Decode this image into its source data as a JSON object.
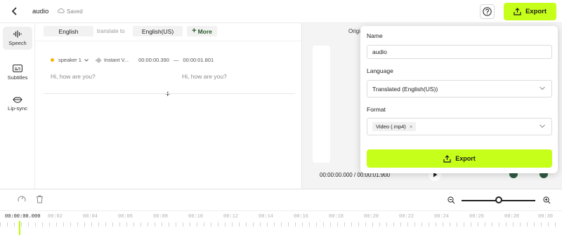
{
  "header": {
    "title": "audio",
    "saved": "Saved",
    "export_label": "Export"
  },
  "rail": {
    "items": [
      {
        "label": "Speech",
        "icon": "waveform-icon"
      },
      {
        "label": "Subtitles",
        "icon": "subtitles-icon"
      },
      {
        "label": "Lip-sync",
        "icon": "lips-icon"
      }
    ]
  },
  "editor": {
    "source_lang": "English",
    "translate_to": "translate to",
    "target_lang": "English(US)",
    "more_label": "More",
    "segment": {
      "speaker": "speaker 1",
      "voice": "Instant V...",
      "start": "00:00:00.390",
      "dash": "—",
      "end": "00:00:01.801",
      "original_text": "Hi, how are you?",
      "translated_text": "Hi, how are you?"
    }
  },
  "preview": {
    "tab_label": "Origi",
    "time_readout": "00:00:00.000 / 00:00:01.900"
  },
  "export_panel": {
    "name_label": "Name",
    "name_value": "audio",
    "language_label": "Language",
    "language_value": "Translated (English(US))",
    "format_label": "Format",
    "format_chip": "Video (.mp4)",
    "export_label": "Export"
  },
  "timeline": {
    "ticks": [
      "00:00:00.000",
      "00:02",
      "00:04",
      "00:06",
      "00:08",
      "00:10",
      "00:12",
      "00:14",
      "00:16",
      "00:18",
      "00:20",
      "00:22",
      "00:24",
      "00:26",
      "00:28",
      "00:30"
    ],
    "zoom_level": 0.5
  },
  "colors": {
    "accent": "#c6ff1a",
    "speaker_dot": "#f5b400"
  }
}
